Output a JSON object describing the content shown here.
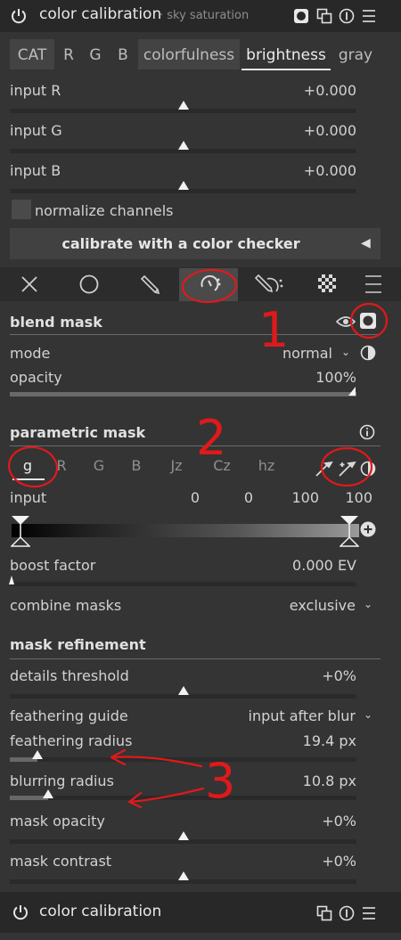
{
  "module": {
    "title": "color calibration",
    "subtitle": "· sky saturation"
  },
  "tabs": [
    "CAT",
    "R",
    "G",
    "B",
    "colorfulness",
    "brightness",
    "gray"
  ],
  "active_tab": "brightness",
  "inputs": [
    {
      "label": "input R",
      "value": "+0.000",
      "level": 0.5
    },
    {
      "label": "input G",
      "value": "+0.000",
      "level": 0.5
    },
    {
      "label": "input B",
      "value": "+0.000",
      "level": 0.5
    }
  ],
  "normalize_label": "normalize channels",
  "calibrate_label": "calibrate with a color checker",
  "mask_icons": [
    "off-icon",
    "uniform-icon",
    "drawn-icon",
    "parametric-icon",
    "drawn-parametric-icon",
    "raster-icon",
    "presets-icon"
  ],
  "blend": {
    "title": "blend mask",
    "mode_label": "mode",
    "mode_value": "normal",
    "opacity_label": "opacity",
    "opacity_value": "100%",
    "opacity_level": 1.0
  },
  "parametric": {
    "title": "parametric mask",
    "channels": [
      "g",
      "R",
      "G",
      "B",
      "Jz",
      "Cz",
      "hz"
    ],
    "active_channel": "g",
    "input_label": "input",
    "input_values": [
      "0",
      "0",
      "100",
      "100"
    ],
    "boost_label": "boost factor",
    "boost_value": "0.000 EV",
    "boost_level": 0.0,
    "combine_label": "combine masks",
    "combine_value": "exclusive"
  },
  "refinement": {
    "title": "mask refinement",
    "details_label": "details threshold",
    "details_value": "+0%",
    "details_level": 0.5,
    "guide_label": "feathering guide",
    "guide_value": "input after blur",
    "feather_label": "feathering radius",
    "feather_value": "19.4 px",
    "feather_level": 0.08,
    "blur_label": "blurring radius",
    "blur_value": "10.8 px",
    "blur_level": 0.11,
    "opacity_label": "mask opacity",
    "opacity_value": "+0%",
    "opacity_level": 0.5,
    "contrast_label": "mask contrast",
    "contrast_value": "+0%",
    "contrast_level": 0.5
  },
  "footer": {
    "title": "color calibration"
  },
  "annotations": [
    "1",
    "2",
    "3"
  ],
  "colors": {
    "background": "#343434",
    "header": "#282828",
    "annotation": "#e0191b"
  }
}
